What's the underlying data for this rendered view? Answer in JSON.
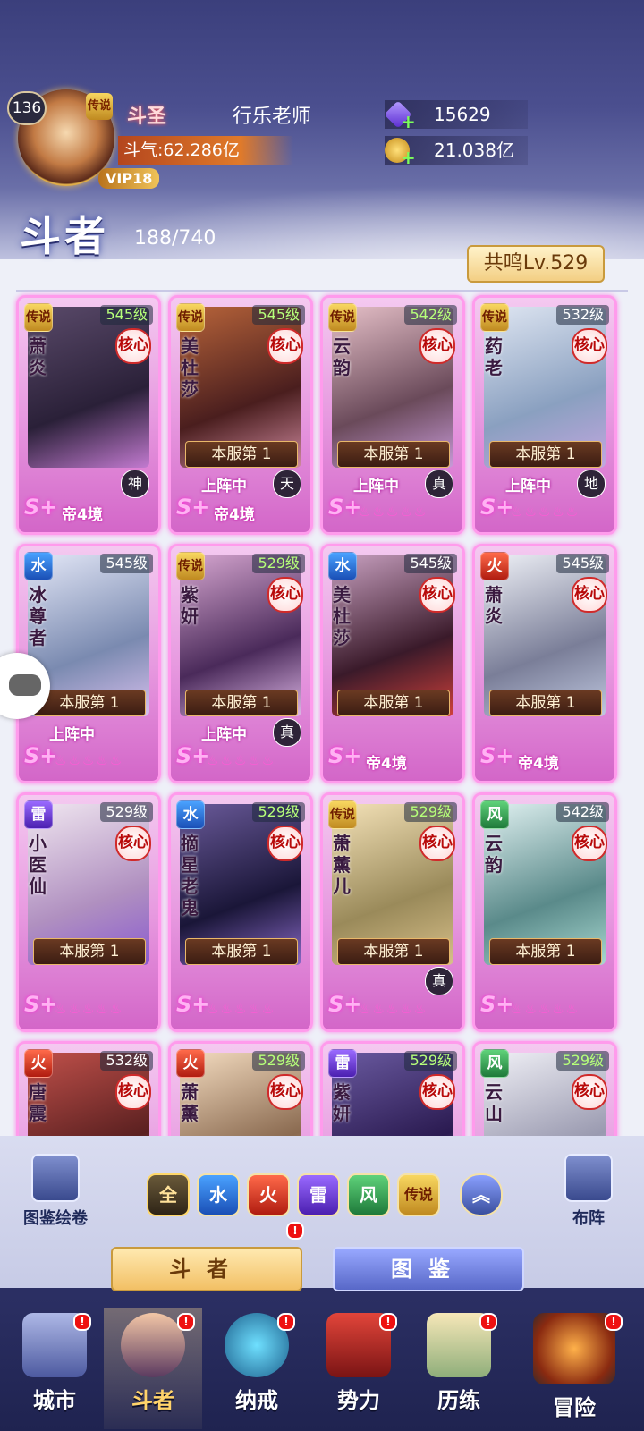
{
  "header": {
    "level": "136",
    "legend_badge": "传说",
    "vip": "VIP18",
    "rank_title": "斗圣",
    "player_name": "行乐老师",
    "power": "斗气:62.286亿",
    "gems": "15629",
    "gold": "21.038亿",
    "section_title": "斗者",
    "count": "188/740",
    "resonance": "共鸣Lv.529"
  },
  "cards": [
    {
      "elem": "传说",
      "elem_type": "legend",
      "level": "545级",
      "name": "萧炎",
      "core": "核心",
      "rank": "",
      "on_team": "",
      "realm": "神",
      "tier": "帝4境",
      "lvl_color": "green"
    },
    {
      "elem": "传说",
      "elem_type": "legend",
      "level": "545级",
      "name": "美杜莎",
      "core": "核心",
      "rank": "本服第 1",
      "on_team": "上阵中",
      "realm": "天",
      "tier": "帝4境",
      "lvl_color": "green"
    },
    {
      "elem": "传说",
      "elem_type": "legend",
      "level": "542级",
      "name": "云韵",
      "core": "核心",
      "rank": "本服第 1",
      "on_team": "上阵中",
      "realm": "真",
      "tier": "",
      "lvl_color": "green"
    },
    {
      "elem": "传说",
      "elem_type": "legend",
      "level": "532级",
      "name": "药老",
      "core": "核心",
      "rank": "本服第 1",
      "on_team": "上阵中",
      "realm": "地",
      "tier": "",
      "lvl_color": "white"
    },
    {
      "elem": "水",
      "elem_type": "water",
      "level": "545级",
      "name": "冰尊者",
      "core": "",
      "rank": "本服第 1",
      "on_team": "上阵中",
      "realm": "",
      "tier": "",
      "lvl_color": "white"
    },
    {
      "elem": "传说",
      "elem_type": "legend",
      "level": "529级",
      "name": "紫妍",
      "core": "核心",
      "rank": "本服第 1",
      "on_team": "上阵中",
      "realm": "真",
      "tier": "",
      "lvl_color": "green"
    },
    {
      "elem": "水",
      "elem_type": "water",
      "level": "545级",
      "name": "美杜莎",
      "core": "核心",
      "rank": "本服第 1",
      "on_team": "",
      "realm": "",
      "tier": "帝4境",
      "lvl_color": "white"
    },
    {
      "elem": "火",
      "elem_type": "fire",
      "level": "545级",
      "name": "萧炎",
      "core": "核心",
      "rank": "本服第 1",
      "on_team": "",
      "realm": "",
      "tier": "帝4境",
      "lvl_color": "white"
    },
    {
      "elem": "雷",
      "elem_type": "thunder",
      "level": "529级",
      "name": "小医仙",
      "core": "核心",
      "rank": "本服第 1",
      "on_team": "",
      "realm": "",
      "tier": "",
      "lvl_color": "white"
    },
    {
      "elem": "水",
      "elem_type": "water",
      "level": "529级",
      "name": "摘星老鬼",
      "core": "核心",
      "rank": "本服第 1",
      "on_team": "",
      "realm": "",
      "tier": "",
      "lvl_color": "green"
    },
    {
      "elem": "传说",
      "elem_type": "legend",
      "level": "529级",
      "name": "萧薰儿",
      "core": "核心",
      "rank": "本服第 1",
      "on_team": "",
      "realm": "真",
      "tier": "",
      "lvl_color": "green"
    },
    {
      "elem": "风",
      "elem_type": "wind",
      "level": "542级",
      "name": "云韵",
      "core": "核心",
      "rank": "本服第 1",
      "on_team": "",
      "realm": "",
      "tier": "",
      "lvl_color": "white"
    },
    {
      "elem": "火",
      "elem_type": "fire",
      "level": "532级",
      "name": "唐震",
      "core": "核心",
      "rank": "",
      "on_team": "",
      "realm": "",
      "tier": "",
      "lvl_color": "white"
    },
    {
      "elem": "火",
      "elem_type": "fire",
      "level": "529级",
      "name": "萧薰",
      "core": "核心",
      "rank": "",
      "on_team": "",
      "realm": "",
      "tier": "",
      "lvl_color": "green"
    },
    {
      "elem": "雷",
      "elem_type": "thunder",
      "level": "529级",
      "name": "紫妍",
      "core": "核心",
      "rank": "",
      "on_team": "",
      "realm": "",
      "tier": "",
      "lvl_color": "green"
    },
    {
      "elem": "风",
      "elem_type": "wind",
      "level": "529级",
      "name": "云山",
      "core": "核心",
      "rank": "",
      "on_team": "",
      "realm": "",
      "tier": "",
      "lvl_color": "green"
    }
  ],
  "splus": "S+",
  "filters": {
    "all": "全",
    "water": "水",
    "fire": "火",
    "thunder": "雷",
    "wind": "风",
    "legend": "传说"
  },
  "side_buttons": {
    "atlas_scroll": "图鉴绘卷",
    "formation": "布阵"
  },
  "tabs": {
    "fighters": "斗者",
    "atlas": "图鉴"
  },
  "nav": {
    "city": "城市",
    "fighters": "斗者",
    "ring": "纳戒",
    "faction": "势力",
    "training": "历练",
    "adventure": "冒险"
  },
  "alert": "!"
}
